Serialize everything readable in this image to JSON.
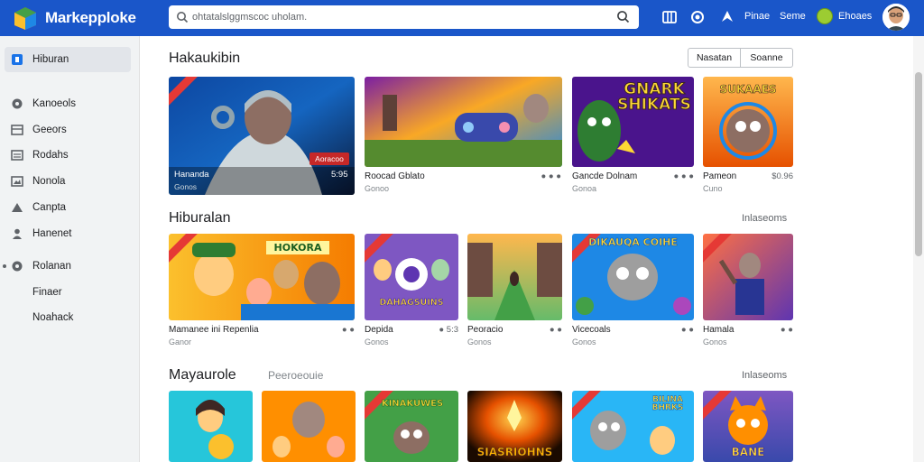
{
  "app": {
    "brand": "Markepploke",
    "search_value": "ohtatalslggmscoc uholam.",
    "header_links": [
      "Pinae",
      "Seme",
      "Ehoaes"
    ]
  },
  "sidebar": {
    "items": [
      {
        "label": "Hiburan",
        "icon": "store-icon"
      },
      {
        "label": "Kanoeols",
        "icon": "controller-icon"
      },
      {
        "label": "Geeors",
        "icon": "grid-icon"
      },
      {
        "label": "Rodahs",
        "icon": "list-icon"
      },
      {
        "label": "Nonola",
        "icon": "image-icon"
      },
      {
        "label": "Canpta",
        "icon": "triangle-icon"
      },
      {
        "label": "Hanenet",
        "icon": "person-icon"
      },
      {
        "label": "Rolanan",
        "icon": "settings-icon"
      },
      {
        "label": "Finaer",
        "icon": ""
      },
      {
        "label": "Noahack",
        "icon": ""
      }
    ]
  },
  "sections": [
    {
      "title": "Hakaukibin",
      "segment": [
        "Nasatan",
        "Soanne"
      ],
      "cards": [
        {
          "title": "Hananda",
          "price": "5:95",
          "sub": "Gonos",
          "overlay_tag": "Aoracoo"
        },
        {
          "title": "Roocad Gblato",
          "price": "● ● ●",
          "sub": "Gonoo"
        },
        {
          "title": "Gancde Dolnam",
          "price": "● ● ●",
          "sub": "Gonoa",
          "art_text": "GNARK SHIKATS"
        },
        {
          "title": "Pameon",
          "price": "$0.96",
          "sub": "Cuno",
          "art_text": "SUKAAES"
        }
      ]
    },
    {
      "title": "Hiburalan",
      "link": "Inlaseoms",
      "cards": [
        {
          "title": "Mamanee  ini  Repenlia",
          "price": "● ●",
          "sub": "Ganor",
          "art_text": "HOKORA"
        },
        {
          "title": "Depida",
          "price": "● 5:3",
          "sub": "Gonos",
          "art_text": "DAHAGSUINS"
        },
        {
          "title": "Peoracio",
          "price": "● ●",
          "sub": "Gonos"
        },
        {
          "title": "Vicecoals",
          "price": "● ●",
          "sub": "Gonos",
          "art_text": "DIKAUQA COIHE"
        },
        {
          "title": "Hamala",
          "price": "● ●",
          "sub": "Gonos"
        }
      ]
    },
    {
      "title": "Mayaurole",
      "subtitle": "Peeroeouie",
      "link": "Inlaseoms",
      "cards": [
        {
          "art_text": ""
        },
        {
          "art_text": ""
        },
        {
          "art_text": "KINAKUWES"
        },
        {
          "art_text": "SIASRIOHNS"
        },
        {
          "art_text": "BILINA BHRKS"
        },
        {
          "art_text": "BANE"
        }
      ]
    }
  ],
  "colors": {
    "topbar": "#1a56c9",
    "sidebar": "#f1f3f4",
    "ribbon": "#e53935"
  }
}
